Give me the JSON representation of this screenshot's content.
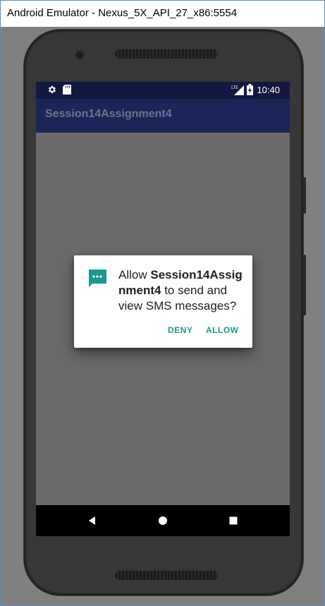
{
  "window": {
    "title": "Android Emulator - Nexus_5X_API_27_x86:5554"
  },
  "statusbar": {
    "time": "10:40",
    "network": "LTE"
  },
  "app": {
    "title": "Session14Assignment4"
  },
  "dialog": {
    "prefix": "Allow ",
    "app_name": "Session14Assignment4",
    "suffix": " to send and view SMS messages?",
    "deny_label": "DENY",
    "allow_label": "ALLOW"
  },
  "colors": {
    "status_bar": "#12193f",
    "app_bar": "#1b2557",
    "dialog_accent": "#1a9a8c",
    "scrim": "#6a6a6a"
  },
  "icons": {
    "status_left": [
      "gear-icon",
      "sd-card-icon"
    ],
    "status_right": [
      "lte-signal-icon",
      "battery-charging-icon"
    ],
    "dialog": "sms-message-icon",
    "nav": [
      "back-icon",
      "home-icon",
      "recents-icon"
    ]
  }
}
